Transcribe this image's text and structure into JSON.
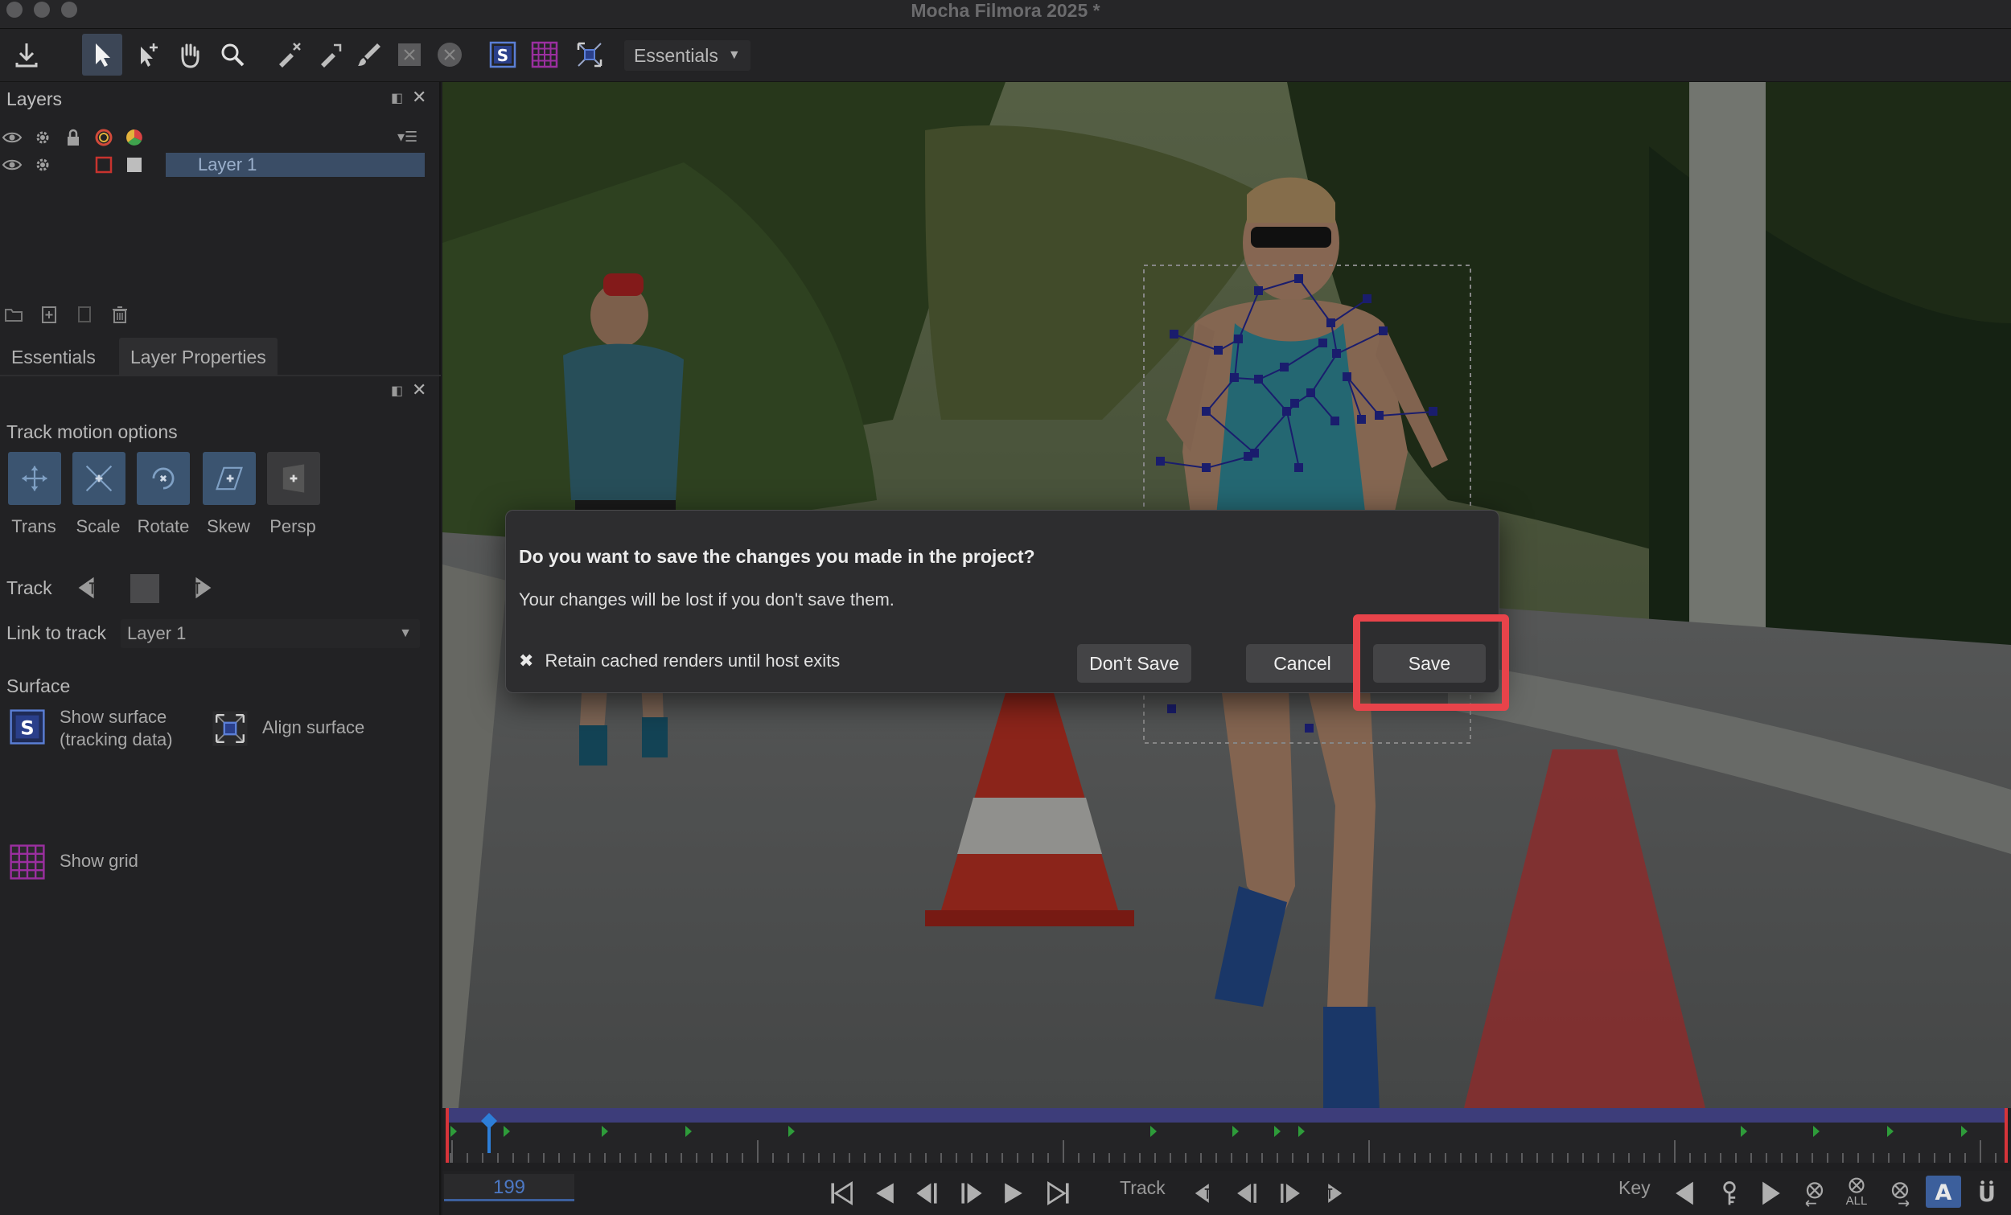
{
  "window": {
    "title": "Mocha Filmora 2025 *"
  },
  "toolbar": {
    "workspace_label": "Essentials"
  },
  "layers_panel": {
    "title": "Layers",
    "layers": [
      {
        "name": "Layer 1"
      }
    ]
  },
  "properties_panel": {
    "tabs": [
      {
        "label": "Essentials",
        "active": false
      },
      {
        "label": "Layer Properties",
        "active": true
      }
    ],
    "track_motion": {
      "title": "Track motion options",
      "options": [
        {
          "label": "Trans",
          "enabled": true
        },
        {
          "label": "Scale",
          "enabled": true
        },
        {
          "label": "Rotate",
          "enabled": true
        },
        {
          "label": "Skew",
          "enabled": true
        },
        {
          "label": "Persp",
          "enabled": false
        }
      ]
    },
    "track_label": "Track",
    "link_to_track": {
      "label": "Link to track",
      "value": "Layer 1"
    },
    "surface": {
      "title": "Surface",
      "show_surface_line1": "Show surface",
      "show_surface_line2": "(tracking data)",
      "align_surface": "Align surface",
      "show_grid": "Show grid"
    }
  },
  "timeline": {
    "current_frame": "199"
  },
  "transport": {
    "track_label": "Track",
    "key_label": "Key",
    "all_label": "ALL"
  },
  "dialog": {
    "question": "Do you want to save the changes you made in the project?",
    "message": "Your changes will be lost if you don't save them.",
    "checkbox_label": "Retain cached renders until host exits",
    "checkbox_checked": true,
    "buttons": {
      "dont_save": "Don't Save",
      "cancel": "Cancel",
      "save": "Save"
    }
  },
  "colors": {
    "accent_blue": "#3b5470",
    "highlight_red": "#e8434a",
    "layer_selected": "#3a4d66",
    "surface_purple": "#9b2fa0"
  }
}
